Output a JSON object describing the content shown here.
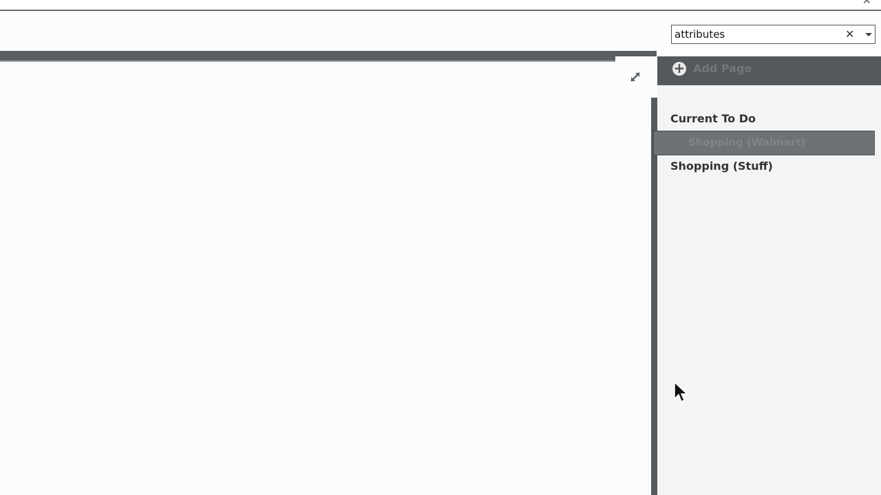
{
  "search": {
    "value": "attributes"
  },
  "icons": {
    "window_close": "close-icon",
    "search_clear": "clear-icon",
    "dropdown": "chevron-down-icon",
    "expand": "expand-icon",
    "add_page": "plus-circle-icon"
  },
  "glyphs": {
    "close": "✕",
    "clear": "✕",
    "plus": "+"
  },
  "sidebar": {
    "add_page_label": "Add Page",
    "pages": [
      {
        "label": "Current To Do",
        "selected": false
      },
      {
        "label": "Shopping (Walmart)",
        "selected": true
      },
      {
        "label": "Shopping (Stuff)",
        "selected": false
      }
    ]
  },
  "colors": {
    "dark_bar": "#55595c",
    "selected_row": "#6f7275",
    "sidebar_bg": "#f3f4f5"
  }
}
